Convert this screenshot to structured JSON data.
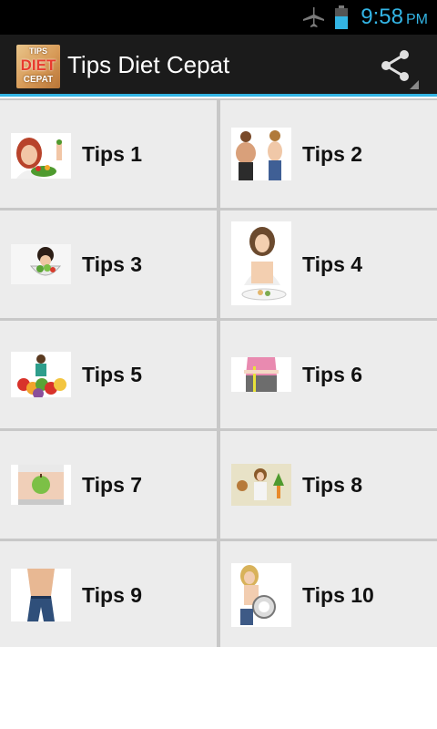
{
  "status_bar": {
    "time": "9:58",
    "ampm": "PM",
    "icons": [
      "airplane-mode-icon",
      "battery-icon"
    ]
  },
  "action_bar": {
    "title": "Tips Diet Cepat",
    "app_icon": {
      "line1": "TIPS",
      "line2": "DIET",
      "line3": "CEPAT"
    },
    "share_icon": "share-icon"
  },
  "colors": {
    "accent": "#33b5e5",
    "action_bar_bg": "#1b1b1b",
    "cell_bg": "#ececec",
    "divider": "#c8c8c8"
  },
  "tips": [
    {
      "label": "Tips 1",
      "image": "woman-eating-salad"
    },
    {
      "label": "Tips 2",
      "image": "before-after-weight-loss"
    },
    {
      "label": "Tips 3",
      "image": "woman-with-vegetable-bowl"
    },
    {
      "label": "Tips 4",
      "image": "woman-with-plate"
    },
    {
      "label": "Tips 5",
      "image": "woman-behind-vegetables"
    },
    {
      "label": "Tips 6",
      "image": "measuring-waist"
    },
    {
      "label": "Tips 7",
      "image": "apple-on-stomach"
    },
    {
      "label": "Tips 8",
      "image": "woman-choosing-food"
    },
    {
      "label": "Tips 9",
      "image": "slim-waist-jeans"
    },
    {
      "label": "Tips 10",
      "image": "woman-on-scale"
    }
  ]
}
